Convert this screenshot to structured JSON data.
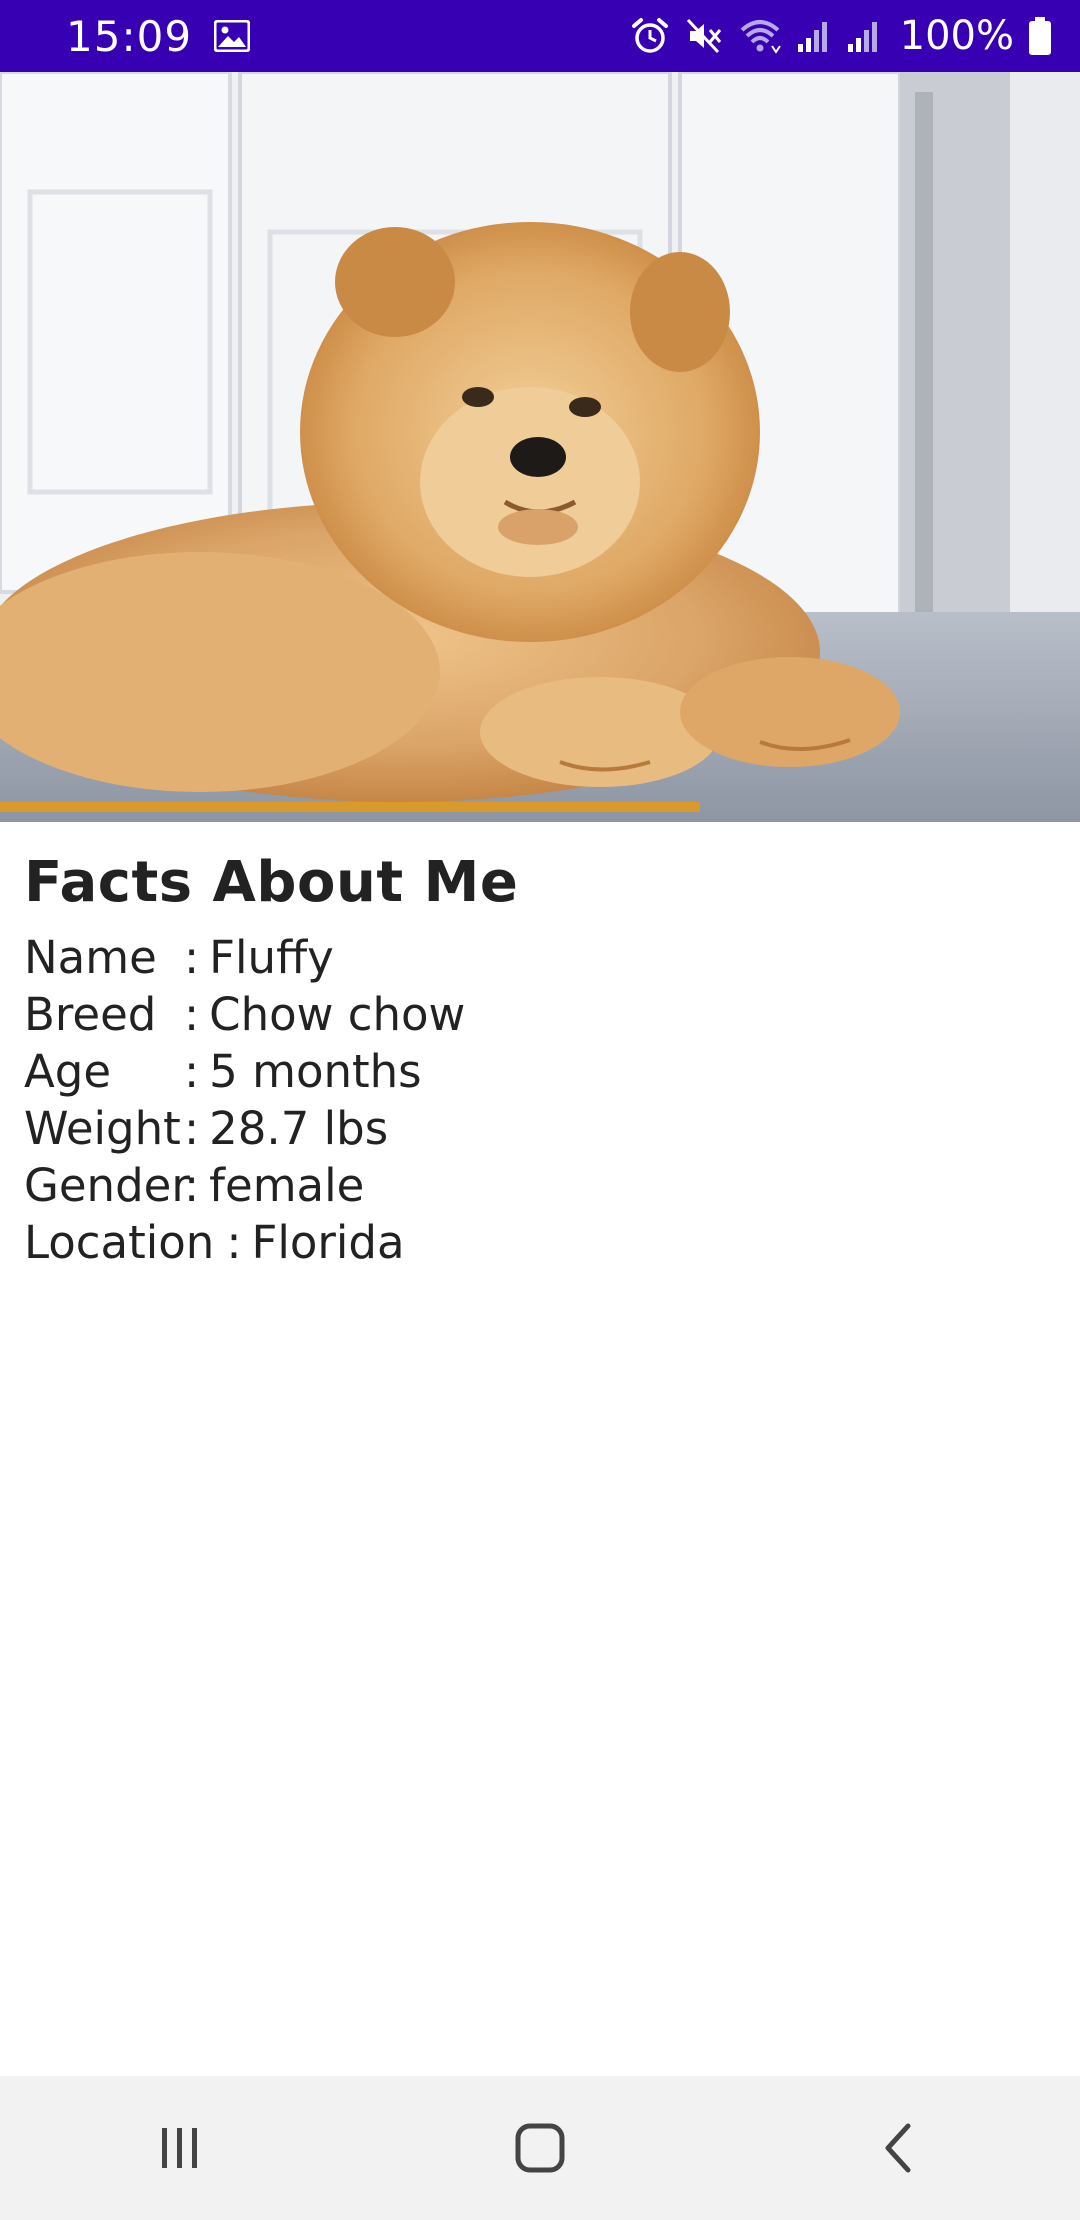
{
  "status_bar": {
    "time": "15:09",
    "battery": "100%",
    "icons": [
      "image-icon",
      "alarm-icon",
      "mute-icon",
      "wifi-icon",
      "signal-icon",
      "signal-icon",
      "battery-icon"
    ],
    "background": "#3700b3"
  },
  "hero": {
    "image_subject": "chow-chow-puppy-photo"
  },
  "facts": {
    "title": "Facts About Me",
    "rows": [
      {
        "label": "Name",
        "sep": ":",
        "value": "Fluffy"
      },
      {
        "label": "Breed",
        "sep": ":",
        "value": "Chow chow"
      },
      {
        "label": "Age",
        "sep": ":",
        "value": "5 months"
      },
      {
        "label": "Weight",
        "sep": ":",
        "value": "28.7 lbs"
      },
      {
        "label": "Gender",
        "sep": ":",
        "value": "female"
      },
      {
        "label": "Location",
        "sep": ":",
        "value": "Florida"
      }
    ]
  },
  "nav_bar": {
    "buttons": [
      "recent-apps-icon",
      "home-icon",
      "back-icon"
    ],
    "background": "#f2f2f2"
  }
}
